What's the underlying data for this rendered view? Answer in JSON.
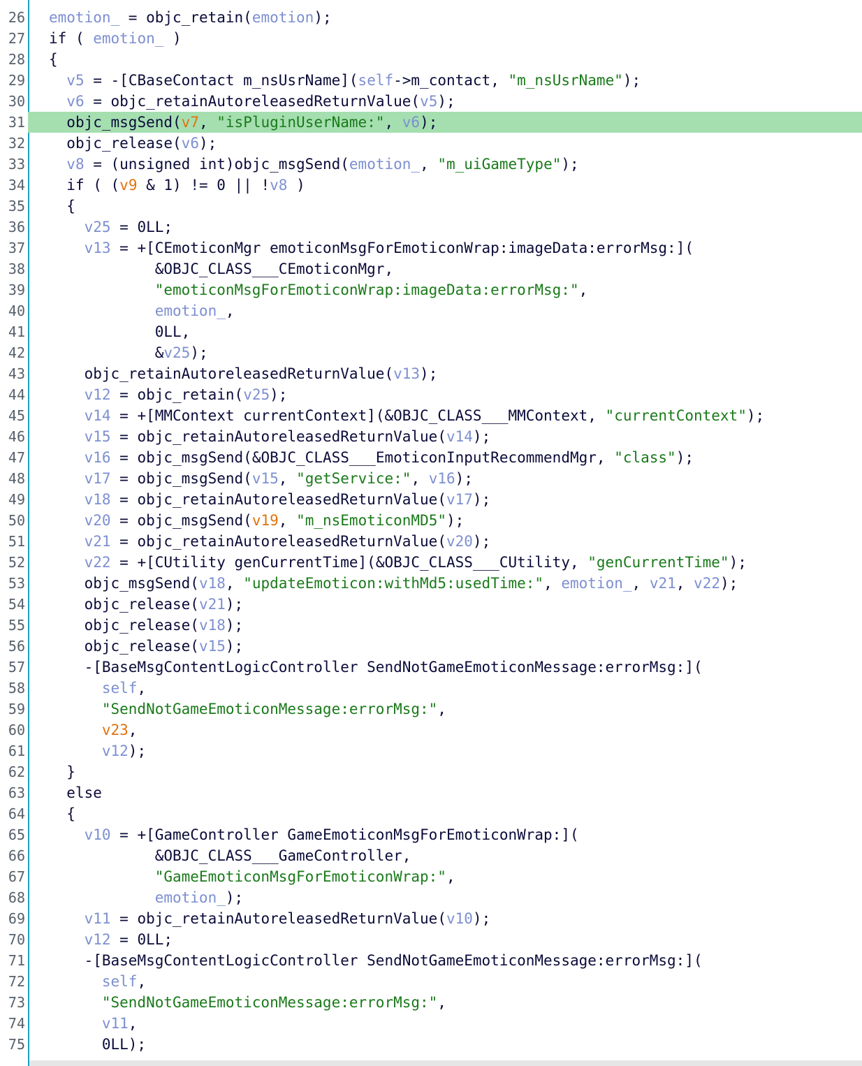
{
  "editor": {
    "top_partial_line_number": "25",
    "lines": [
      {
        "n": "26",
        "indent": 0,
        "tokens": [
          [
            "v",
            "emotion_"
          ],
          [
            "p",
            " = "
          ],
          [
            "f",
            "objc_retain"
          ],
          [
            "p",
            "("
          ],
          [
            "v",
            "emotion"
          ],
          [
            "p",
            ");"
          ]
        ]
      },
      {
        "n": "27",
        "indent": 0,
        "tokens": [
          [
            "k",
            "if"
          ],
          [
            "p",
            " ( "
          ],
          [
            "v",
            "emotion_"
          ],
          [
            "p",
            " )"
          ]
        ]
      },
      {
        "n": "28",
        "indent": 0,
        "tokens": [
          [
            "p",
            "{"
          ]
        ]
      },
      {
        "n": "29",
        "indent": 2,
        "tokens": [
          [
            "v",
            "v5"
          ],
          [
            "p",
            " = -["
          ],
          [
            "f",
            "CBaseContact m_nsUsrName"
          ],
          [
            "p",
            "]("
          ],
          [
            "v",
            "self"
          ],
          [
            "p",
            "->m_contact, "
          ],
          [
            "s",
            "\"m_nsUsrName\""
          ],
          [
            "p",
            ");"
          ]
        ]
      },
      {
        "n": "30",
        "indent": 2,
        "tokens": [
          [
            "v",
            "v6"
          ],
          [
            "p",
            " = "
          ],
          [
            "f",
            "objc_retainAutoreleasedReturnValue"
          ],
          [
            "p",
            "("
          ],
          [
            "v",
            "v5"
          ],
          [
            "p",
            ");"
          ]
        ]
      },
      {
        "n": "31",
        "indent": 2,
        "highlight": true,
        "tokens": [
          [
            "f",
            "objc_msgSend"
          ],
          [
            "p",
            "("
          ],
          [
            "o",
            "v7"
          ],
          [
            "p",
            ", "
          ],
          [
            "s",
            "\"isPluginUserName:\""
          ],
          [
            "p",
            ", "
          ],
          [
            "v",
            "v6"
          ],
          [
            "p",
            ");"
          ]
        ]
      },
      {
        "n": "32",
        "indent": 2,
        "tokens": [
          [
            "f",
            "objc_release"
          ],
          [
            "p",
            "("
          ],
          [
            "v",
            "v6"
          ],
          [
            "p",
            ");"
          ]
        ]
      },
      {
        "n": "33",
        "indent": 2,
        "tokens": [
          [
            "v",
            "v8"
          ],
          [
            "p",
            " = (unsigned int)"
          ],
          [
            "f",
            "objc_msgSend"
          ],
          [
            "p",
            "("
          ],
          [
            "v",
            "emotion_"
          ],
          [
            "p",
            ", "
          ],
          [
            "s",
            "\"m_uiGameType\""
          ],
          [
            "p",
            ");"
          ]
        ]
      },
      {
        "n": "34",
        "indent": 2,
        "tokens": [
          [
            "k",
            "if"
          ],
          [
            "p",
            " ( ("
          ],
          [
            "o",
            "v9"
          ],
          [
            "p",
            " & 1) != 0 || !"
          ],
          [
            "v",
            "v8"
          ],
          [
            "p",
            " )"
          ]
        ]
      },
      {
        "n": "35",
        "indent": 2,
        "tokens": [
          [
            "p",
            "{"
          ]
        ]
      },
      {
        "n": "36",
        "indent": 4,
        "tokens": [
          [
            "v",
            "v25"
          ],
          [
            "p",
            " = 0LL;"
          ]
        ]
      },
      {
        "n": "37",
        "indent": 4,
        "tokens": [
          [
            "v",
            "v13"
          ],
          [
            "p",
            " = +["
          ],
          [
            "f",
            "CEmoticonMgr emoticonMsgForEmoticonWrap:imageData:errorMsg:"
          ],
          [
            "p",
            "]("
          ]
        ]
      },
      {
        "n": "38",
        "indent": 12,
        "tokens": [
          [
            "p",
            "&OBJC_CLASS___CEmoticonMgr,"
          ]
        ]
      },
      {
        "n": "39",
        "indent": 12,
        "tokens": [
          [
            "s",
            "\"emoticonMsgForEmoticonWrap:imageData:errorMsg:\""
          ],
          [
            "p",
            ","
          ]
        ]
      },
      {
        "n": "40",
        "indent": 12,
        "tokens": [
          [
            "v",
            "emotion_"
          ],
          [
            "p",
            ","
          ]
        ]
      },
      {
        "n": "41",
        "indent": 12,
        "tokens": [
          [
            "p",
            "0LL,"
          ]
        ]
      },
      {
        "n": "42",
        "indent": 12,
        "tokens": [
          [
            "p",
            "&"
          ],
          [
            "v",
            "v25"
          ],
          [
            "p",
            ");"
          ]
        ]
      },
      {
        "n": "43",
        "indent": 4,
        "tokens": [
          [
            "f",
            "objc_retainAutoreleasedReturnValue"
          ],
          [
            "p",
            "("
          ],
          [
            "v",
            "v13"
          ],
          [
            "p",
            ");"
          ]
        ]
      },
      {
        "n": "44",
        "indent": 4,
        "tokens": [
          [
            "v",
            "v12"
          ],
          [
            "p",
            " = "
          ],
          [
            "f",
            "objc_retain"
          ],
          [
            "p",
            "("
          ],
          [
            "v",
            "v25"
          ],
          [
            "p",
            ");"
          ]
        ]
      },
      {
        "n": "45",
        "indent": 4,
        "tokens": [
          [
            "v",
            "v14"
          ],
          [
            "p",
            " = +["
          ],
          [
            "f",
            "MMContext currentContext"
          ],
          [
            "p",
            "](&OBJC_CLASS___MMContext, "
          ],
          [
            "s",
            "\"currentContext\""
          ],
          [
            "p",
            ");"
          ]
        ]
      },
      {
        "n": "46",
        "indent": 4,
        "tokens": [
          [
            "v",
            "v15"
          ],
          [
            "p",
            " = "
          ],
          [
            "f",
            "objc_retainAutoreleasedReturnValue"
          ],
          [
            "p",
            "("
          ],
          [
            "v",
            "v14"
          ],
          [
            "p",
            ");"
          ]
        ]
      },
      {
        "n": "47",
        "indent": 4,
        "tokens": [
          [
            "v",
            "v16"
          ],
          [
            "p",
            " = "
          ],
          [
            "f",
            "objc_msgSend"
          ],
          [
            "p",
            "(&OBJC_CLASS___EmoticonInputRecommendMgr, "
          ],
          [
            "s",
            "\"class\""
          ],
          [
            "p",
            ");"
          ]
        ]
      },
      {
        "n": "48",
        "indent": 4,
        "tokens": [
          [
            "v",
            "v17"
          ],
          [
            "p",
            " = "
          ],
          [
            "f",
            "objc_msgSend"
          ],
          [
            "p",
            "("
          ],
          [
            "v",
            "v15"
          ],
          [
            "p",
            ", "
          ],
          [
            "s",
            "\"getService:\""
          ],
          [
            "p",
            ", "
          ],
          [
            "v",
            "v16"
          ],
          [
            "p",
            ");"
          ]
        ]
      },
      {
        "n": "49",
        "indent": 4,
        "tokens": [
          [
            "v",
            "v18"
          ],
          [
            "p",
            " = "
          ],
          [
            "f",
            "objc_retainAutoreleasedReturnValue"
          ],
          [
            "p",
            "("
          ],
          [
            "v",
            "v17"
          ],
          [
            "p",
            ");"
          ]
        ]
      },
      {
        "n": "50",
        "indent": 4,
        "tokens": [
          [
            "v",
            "v20"
          ],
          [
            "p",
            " = "
          ],
          [
            "f",
            "objc_msgSend"
          ],
          [
            "p",
            "("
          ],
          [
            "o",
            "v19"
          ],
          [
            "p",
            ", "
          ],
          [
            "s",
            "\"m_nsEmoticonMD5\""
          ],
          [
            "p",
            ");"
          ]
        ]
      },
      {
        "n": "51",
        "indent": 4,
        "tokens": [
          [
            "v",
            "v21"
          ],
          [
            "p",
            " = "
          ],
          [
            "f",
            "objc_retainAutoreleasedReturnValue"
          ],
          [
            "p",
            "("
          ],
          [
            "v",
            "v20"
          ],
          [
            "p",
            ");"
          ]
        ]
      },
      {
        "n": "52",
        "indent": 4,
        "tokens": [
          [
            "v",
            "v22"
          ],
          [
            "p",
            " = +["
          ],
          [
            "f",
            "CUtility genCurrentTime"
          ],
          [
            "p",
            "](&OBJC_CLASS___CUtility, "
          ],
          [
            "s",
            "\"genCurrentTime\""
          ],
          [
            "p",
            ");"
          ]
        ]
      },
      {
        "n": "53",
        "indent": 4,
        "tokens": [
          [
            "f",
            "objc_msgSend"
          ],
          [
            "p",
            "("
          ],
          [
            "v",
            "v18"
          ],
          [
            "p",
            ", "
          ],
          [
            "s",
            "\"updateEmoticon:withMd5:usedTime:\""
          ],
          [
            "p",
            ", "
          ],
          [
            "v",
            "emotion_"
          ],
          [
            "p",
            ", "
          ],
          [
            "v",
            "v21"
          ],
          [
            "p",
            ", "
          ],
          [
            "v",
            "v22"
          ],
          [
            "p",
            ");"
          ]
        ]
      },
      {
        "n": "54",
        "indent": 4,
        "tokens": [
          [
            "f",
            "objc_release"
          ],
          [
            "p",
            "("
          ],
          [
            "v",
            "v21"
          ],
          [
            "p",
            ");"
          ]
        ]
      },
      {
        "n": "55",
        "indent": 4,
        "tokens": [
          [
            "f",
            "objc_release"
          ],
          [
            "p",
            "("
          ],
          [
            "v",
            "v18"
          ],
          [
            "p",
            ");"
          ]
        ]
      },
      {
        "n": "56",
        "indent": 4,
        "tokens": [
          [
            "f",
            "objc_release"
          ],
          [
            "p",
            "("
          ],
          [
            "v",
            "v15"
          ],
          [
            "p",
            ");"
          ]
        ]
      },
      {
        "n": "57",
        "indent": 4,
        "tokens": [
          [
            "p",
            "-["
          ],
          [
            "f",
            "BaseMsgContentLogicController SendNotGameEmoticonMessage:errorMsg:"
          ],
          [
            "p",
            "]("
          ]
        ]
      },
      {
        "n": "58",
        "indent": 6,
        "tokens": [
          [
            "v",
            "self"
          ],
          [
            "p",
            ","
          ]
        ]
      },
      {
        "n": "59",
        "indent": 6,
        "tokens": [
          [
            "s",
            "\"SendNotGameEmoticonMessage:errorMsg:\""
          ],
          [
            "p",
            ","
          ]
        ]
      },
      {
        "n": "60",
        "indent": 6,
        "tokens": [
          [
            "o",
            "v23"
          ],
          [
            "p",
            ","
          ]
        ]
      },
      {
        "n": "61",
        "indent": 6,
        "tokens": [
          [
            "v",
            "v12"
          ],
          [
            "p",
            ");"
          ]
        ]
      },
      {
        "n": "62",
        "indent": 2,
        "tokens": [
          [
            "p",
            "}"
          ]
        ]
      },
      {
        "n": "63",
        "indent": 2,
        "tokens": [
          [
            "k",
            "else"
          ]
        ]
      },
      {
        "n": "64",
        "indent": 2,
        "tokens": [
          [
            "p",
            "{"
          ]
        ]
      },
      {
        "n": "65",
        "indent": 4,
        "tokens": [
          [
            "v",
            "v10"
          ],
          [
            "p",
            " = +["
          ],
          [
            "f",
            "GameController GameEmoticonMsgForEmoticonWrap:"
          ],
          [
            "p",
            "]("
          ]
        ]
      },
      {
        "n": "66",
        "indent": 12,
        "tokens": [
          [
            "p",
            "&OBJC_CLASS___GameController,"
          ]
        ]
      },
      {
        "n": "67",
        "indent": 12,
        "tokens": [
          [
            "s",
            "\"GameEmoticonMsgForEmoticonWrap:\""
          ],
          [
            "p",
            ","
          ]
        ]
      },
      {
        "n": "68",
        "indent": 12,
        "tokens": [
          [
            "v",
            "emotion_"
          ],
          [
            "p",
            ");"
          ]
        ]
      },
      {
        "n": "69",
        "indent": 4,
        "tokens": [
          [
            "v",
            "v11"
          ],
          [
            "p",
            " = "
          ],
          [
            "f",
            "objc_retainAutoreleasedReturnValue"
          ],
          [
            "p",
            "("
          ],
          [
            "v",
            "v10"
          ],
          [
            "p",
            ");"
          ]
        ]
      },
      {
        "n": "70",
        "indent": 4,
        "tokens": [
          [
            "v",
            "v12"
          ],
          [
            "p",
            " = 0LL;"
          ]
        ]
      },
      {
        "n": "71",
        "indent": 4,
        "tokens": [
          [
            "p",
            "-["
          ],
          [
            "f",
            "BaseMsgContentLogicController SendNotGameEmoticonMessage:errorMsg:"
          ],
          [
            "p",
            "]("
          ]
        ]
      },
      {
        "n": "72",
        "indent": 6,
        "tokens": [
          [
            "v",
            "self"
          ],
          [
            "p",
            ","
          ]
        ]
      },
      {
        "n": "73",
        "indent": 6,
        "tokens": [
          [
            "s",
            "\"SendNotGameEmoticonMessage:errorMsg:\""
          ],
          [
            "p",
            ","
          ]
        ]
      },
      {
        "n": "74",
        "indent": 6,
        "tokens": [
          [
            "v",
            "v11"
          ],
          [
            "p",
            ","
          ]
        ]
      },
      {
        "n": "75",
        "indent": 6,
        "tokens": [
          [
            "p",
            "0LL);"
          ]
        ]
      }
    ],
    "colors": {
      "highlight": "#a5dfb0",
      "gutter_divider": "#1ba0c4",
      "variable": "#7d8fd0",
      "string": "#1a7a1a",
      "undefined_var": "#e2720c",
      "text": "#0b0b3a"
    }
  }
}
